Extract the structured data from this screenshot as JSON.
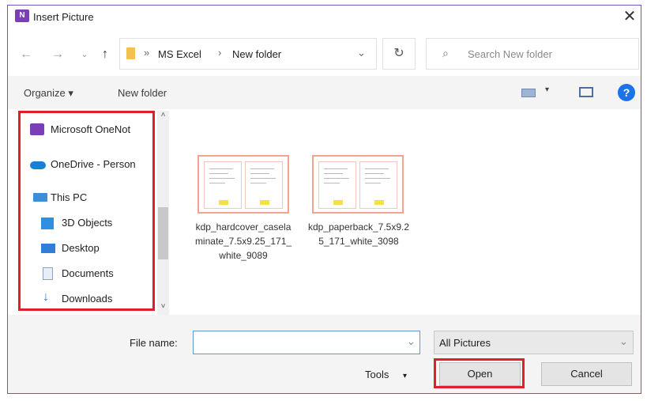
{
  "dialog": {
    "title": "Insert Picture",
    "close_glyph": "✕"
  },
  "nav": {
    "path": [
      "MS Excel",
      "New folder"
    ],
    "search_placeholder": "Search New folder"
  },
  "toolbar": {
    "organize": "Organize ▾",
    "new_folder": "New folder"
  },
  "sidebar": {
    "items": [
      {
        "label": "Microsoft OneNot",
        "icon": "onenote-icon"
      },
      {
        "label": "OneDrive - Person",
        "icon": "cloud-icon"
      },
      {
        "label": "This PC",
        "icon": "computer-icon"
      },
      {
        "label": "3D Objects",
        "icon": "cube-icon"
      },
      {
        "label": "Desktop",
        "icon": "desktop-icon"
      },
      {
        "label": "Documents",
        "icon": "document-icon"
      },
      {
        "label": "Downloads",
        "icon": "download-icon"
      }
    ]
  },
  "files": [
    {
      "name": "kdp_hardcover_caselaminate_7.5x9.25_171_white_9089"
    },
    {
      "name": "kdp_paperback_7.5x9.25_171_white_3098"
    }
  ],
  "footer": {
    "file_name_label": "File name:",
    "file_name_value": "",
    "file_type": "All Pictures",
    "tools": "Tools",
    "open": "Open",
    "cancel": "Cancel"
  },
  "colors": {
    "highlight": "#e01e2c",
    "accent": "#1a73e8",
    "onenote": "#7b3fb5"
  }
}
